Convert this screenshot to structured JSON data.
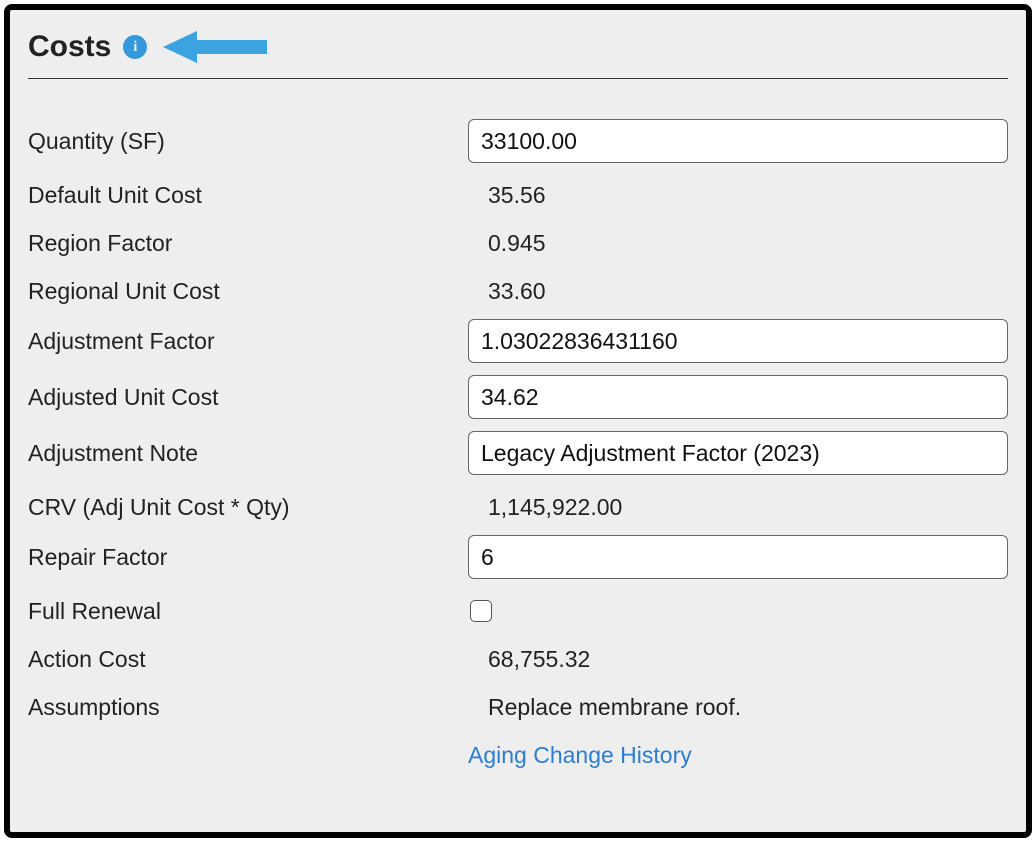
{
  "panel": {
    "title": "Costs",
    "info_tooltip": "i"
  },
  "fields": {
    "quantity": {
      "label": "Quantity (SF)",
      "value": "33100.00"
    },
    "default_unit_cost": {
      "label": "Default Unit Cost",
      "value": "35.56"
    },
    "region_factor": {
      "label": "Region Factor",
      "value": "0.945"
    },
    "regional_unit_cost": {
      "label": "Regional Unit Cost",
      "value": "33.60"
    },
    "adjustment_factor": {
      "label": "Adjustment Factor",
      "value": "1.03022836431160"
    },
    "adjusted_unit_cost": {
      "label": "Adjusted Unit Cost",
      "value": "34.62"
    },
    "adjustment_note": {
      "label": "Adjustment Note",
      "value": "Legacy Adjustment Factor (2023)"
    },
    "crv": {
      "label": "CRV (Adj Unit Cost * Qty)",
      "value": "1,145,922.00"
    },
    "repair_factor": {
      "label": "Repair Factor",
      "value": "6"
    },
    "full_renewal": {
      "label": "Full Renewal",
      "checked": false
    },
    "action_cost": {
      "label": "Action Cost",
      "value": "68,755.32"
    },
    "assumptions": {
      "label": "Assumptions",
      "value": "Replace membrane roof."
    }
  },
  "links": {
    "aging_history": "Aging Change History"
  },
  "colors": {
    "info_icon_bg": "#3498db",
    "arrow": "#3ba3e0",
    "link": "#2d7dd2",
    "panel_bg": "#eeeeee"
  }
}
